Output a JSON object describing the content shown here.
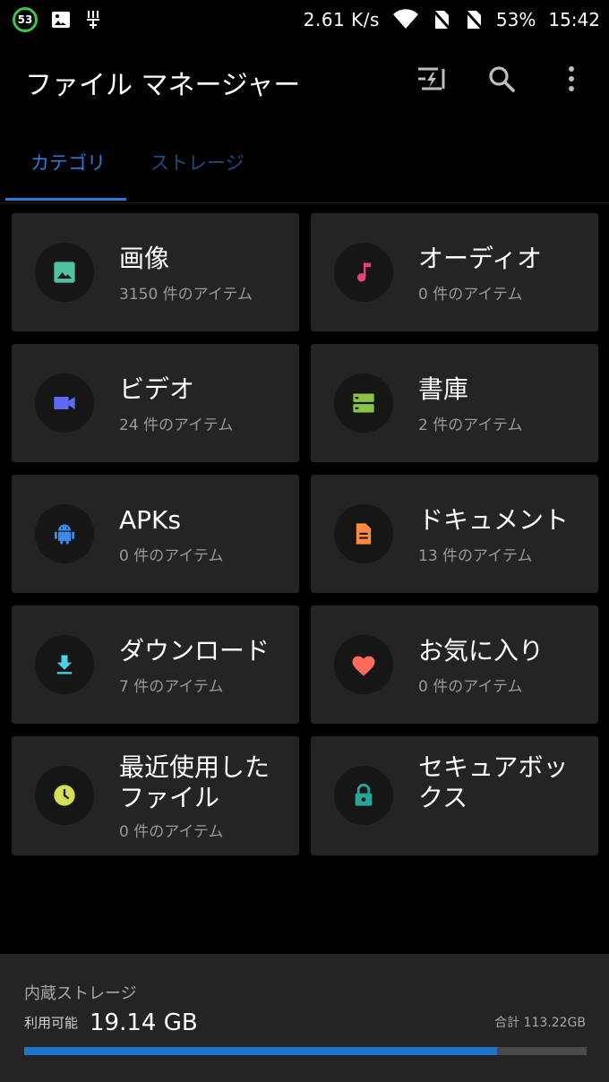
{
  "status_bar": {
    "badge": "53",
    "speed": "2.61 K/s",
    "battery": "53%",
    "time": "15:42"
  },
  "app_bar": {
    "title": "ファイル マネージャー",
    "icons": [
      "flash-transfer-icon",
      "search-icon",
      "more-vert-icon"
    ]
  },
  "tabs": [
    {
      "label": "カテゴリ",
      "active": true
    },
    {
      "label": "ストレージ",
      "active": false
    }
  ],
  "categories": [
    {
      "title": "画像",
      "count": "3150 件のアイテム",
      "icon": "image-icon",
      "color": "#4fc3a1"
    },
    {
      "title": "オーディオ",
      "count": "0 件のアイテム",
      "icon": "music-note-icon",
      "color": "#ec407a"
    },
    {
      "title": "ビデオ",
      "count": "24 件のアイテム",
      "icon": "videocam-icon",
      "color": "#5c6bf2"
    },
    {
      "title": "書庫",
      "count": "2 件のアイテム",
      "icon": "archive-icon",
      "color": "#8bc34a"
    },
    {
      "title": "APKs",
      "count": "0 件のアイテム",
      "icon": "android-icon",
      "color": "#3d8be8"
    },
    {
      "title": "ドキュメント",
      "count": "13 件のアイテム",
      "icon": "document-icon",
      "color": "#ff8a3d"
    },
    {
      "title": "ダウンロード",
      "count": "7 件のアイテム",
      "icon": "download-icon",
      "color": "#4dd0e1"
    },
    {
      "title": "お気に入り",
      "count": "0 件のアイテム",
      "icon": "heart-icon",
      "color": "#ff6b5b"
    },
    {
      "title": "最近使用したファイル",
      "count": "0 件のアイテム",
      "icon": "clock-icon",
      "color": "#d4e157"
    },
    {
      "title": "セキュアボックス",
      "count": "",
      "icon": "lock-icon",
      "color": "#26a69a"
    }
  ],
  "storage": {
    "title": "内蔵ストレージ",
    "available_label": "利用可能",
    "available_value": "19.14 GB",
    "total": "合計 113.22GB",
    "used_fraction": 0.84
  }
}
